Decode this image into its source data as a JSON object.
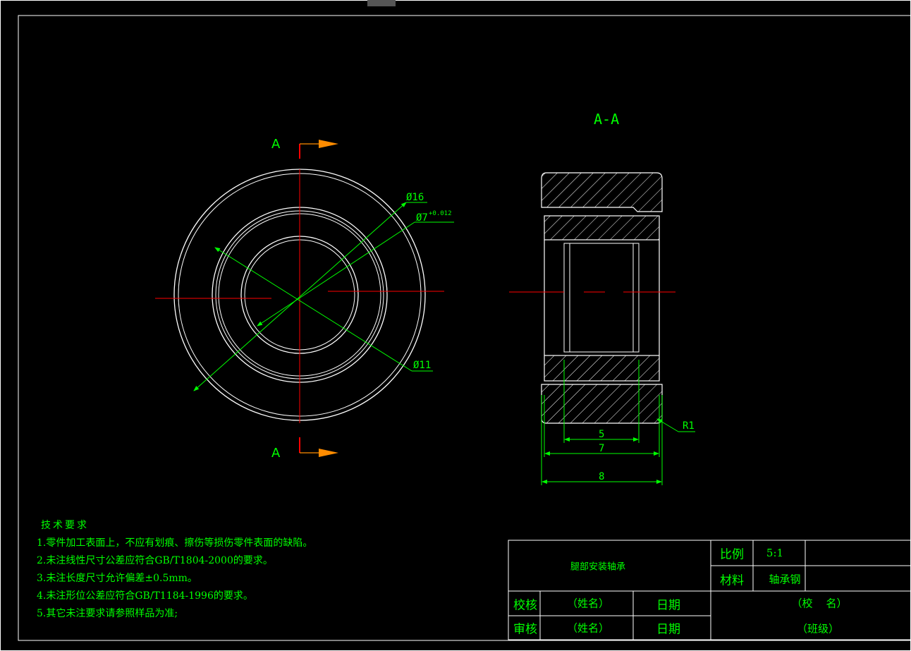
{
  "views": {
    "section_title": "A-A",
    "cut_label_top": "A",
    "cut_label_bottom": "A"
  },
  "dimensions": {
    "outer_dia": "Ø16",
    "bore_dia": "Ø7",
    "bore_tol": "+0.012",
    "race_dia": "Ø11",
    "fillet": "R1",
    "inner_width": "5",
    "ring_width": "7",
    "total_width": "8"
  },
  "tech_requirements": {
    "heading": "技术要求",
    "items": [
      "1.零件加工表面上，不应有划痕、擦伤等损伤零件表面的缺陷。",
      "2.未注线性尺寸公差应符合GB/T1804-2000的要求。",
      "3.未注长度尺寸允许偏差±0.5mm。",
      "4.未注形位公差应符合GB/T1184-1996的要求。",
      "5.其它未注要求请参照样品为准;"
    ]
  },
  "title_block": {
    "part_name": "腿部安装轴承",
    "scale_label": "比例",
    "scale_value": "5:1",
    "material_label": "材料",
    "material_value": "轴承钢",
    "check_label": "校核",
    "check_name": "（姓名）",
    "check_date": "日期",
    "review_label": "审核",
    "review_name": "（姓名）",
    "review_date": "日期",
    "school": "（校    名）",
    "class": "（班级）"
  },
  "colors": {
    "outline": "#ffffff",
    "center_line": "#ff0000",
    "dimension": "#00ff00",
    "cut_arrow": "#ff8c00",
    "hatch": "#ffffff"
  }
}
